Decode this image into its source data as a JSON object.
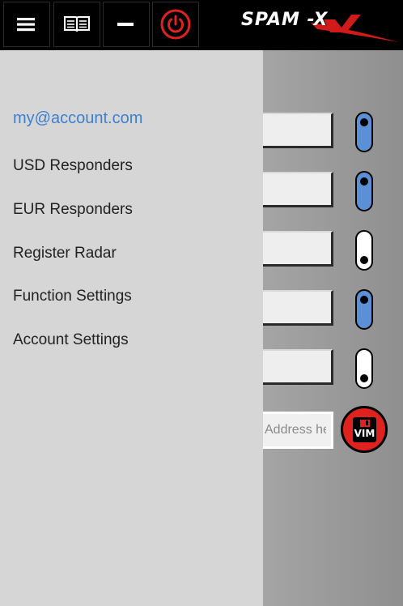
{
  "toolbar": {
    "menu_icon": "hamburger-menu-icon",
    "book_icon": "open-book-icon",
    "minimize_icon": "minus-icon",
    "power_icon": "power-icon",
    "power_color": "#e0221e",
    "brand_name": "SPAM -X"
  },
  "drawer": {
    "account": "my@account.com",
    "account_color": "#3d7fd0",
    "items": [
      {
        "label": "USD Responders"
      },
      {
        "label": "EUR Responders"
      },
      {
        "label": "Register Radar"
      },
      {
        "label": "Function Settings"
      },
      {
        "label": "Account Settings"
      }
    ]
  },
  "main": {
    "toggles": [
      {
        "state": "on"
      },
      {
        "state": "on"
      },
      {
        "state": "off"
      },
      {
        "state": "on"
      },
      {
        "state": "off"
      }
    ],
    "toggle_on_color": "#5b8fd6",
    "address_placeholder": "Address here",
    "save_button": {
      "icon": "floppy-disk-icon",
      "label": "VIM",
      "color": "#e0221e"
    }
  }
}
